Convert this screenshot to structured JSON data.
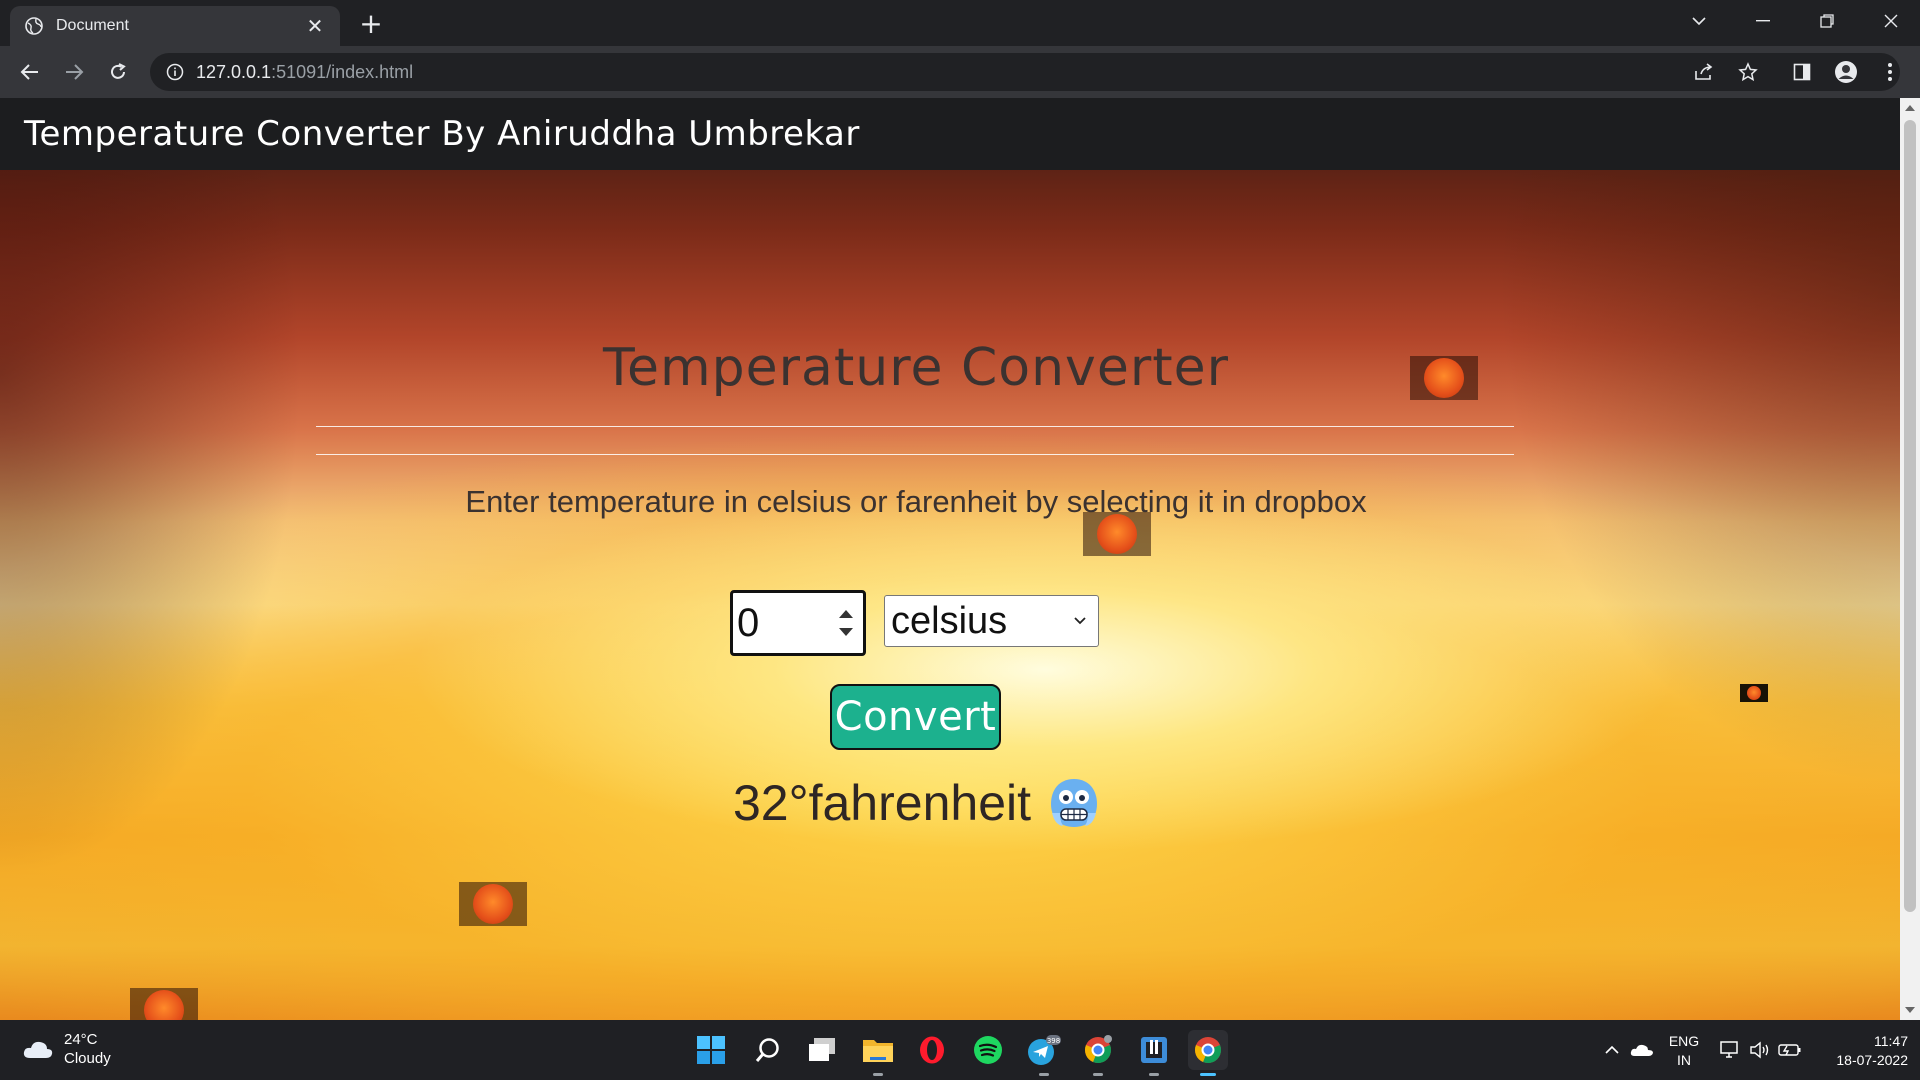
{
  "browser": {
    "tab_title": "Document",
    "close_glyph": "✕",
    "new_tab_glyph": "+",
    "url_host": "127.0.0.1",
    "url_path": ":51091/index.html"
  },
  "page": {
    "brand": "Temperature Converter By Aniruddha Umbrekar",
    "heading": "Temperature Converter",
    "instructions": "Enter temperature in celsius or farenheit by selecting it in dropbox",
    "temperature_value": "0",
    "unit_selected": "celsius",
    "convert_label": "Convert",
    "result_text": "32°fahrenheit",
    "result_emoji": "cold-face-emoji"
  },
  "taskbar": {
    "weather_temp": "24°C",
    "weather_condition": "Cloudy",
    "telegram_badge": "398",
    "lang_line1": "ENG",
    "lang_line2": "IN",
    "time": "11:47",
    "date": "18-07-2022"
  },
  "colors": {
    "navbar_bg": "#1c1d1f",
    "convert_button_bg": "#1cb18e",
    "heading_text": "#3b3230"
  }
}
